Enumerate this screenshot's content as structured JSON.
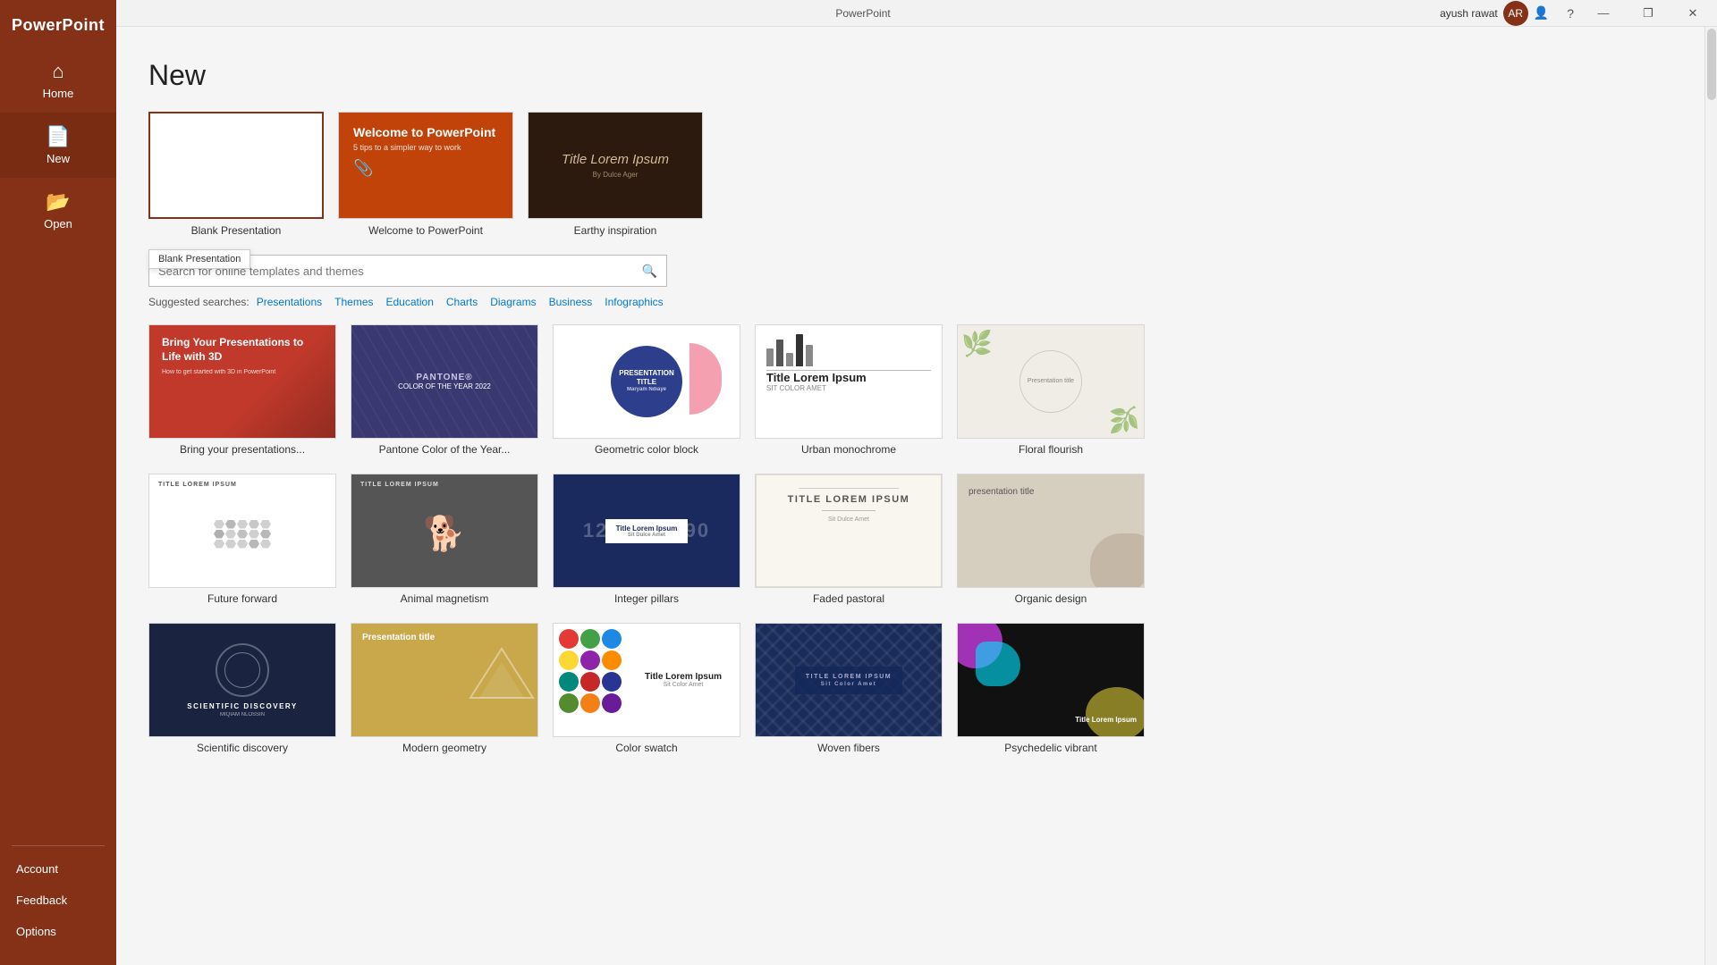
{
  "app": {
    "name": "PowerPoint",
    "title": "PowerPoint",
    "user": "ayush rawat",
    "user_initials": "AR"
  },
  "titlebar": {
    "minimize": "—",
    "restore": "❐",
    "close": "✕",
    "help": "?"
  },
  "sidebar": {
    "brand": "PowerPoint",
    "home_label": "Home",
    "new_label": "New",
    "open_label": "Open",
    "account_label": "Account",
    "feedback_label": "Feedback",
    "options_label": "Options"
  },
  "page": {
    "title": "New"
  },
  "featured": [
    {
      "label": "Blank Presentation",
      "tooltip": "Blank Presentation",
      "type": "blank",
      "selected": true
    },
    {
      "label": "Welcome to PowerPoint",
      "type": "welcome"
    },
    {
      "label": "Earthy inspiration",
      "type": "earthy"
    }
  ],
  "search": {
    "placeholder": "Search for online templates and themes",
    "value": ""
  },
  "suggested": {
    "label": "Suggested searches:",
    "items": [
      "Presentations",
      "Themes",
      "Education",
      "Charts",
      "Diagrams",
      "Business",
      "Infographics"
    ]
  },
  "templates": [
    {
      "id": "bring",
      "label": "Bring your presentations...",
      "type": "bring"
    },
    {
      "id": "pantone",
      "label": "Pantone Color of the Year...",
      "type": "pantone"
    },
    {
      "id": "geometric",
      "label": "Geometric color block",
      "type": "geometric"
    },
    {
      "id": "urban",
      "label": "Urban monochrome",
      "type": "urban"
    },
    {
      "id": "floral",
      "label": "Floral flourish",
      "type": "floral"
    },
    {
      "id": "future",
      "label": "Future forward",
      "type": "future"
    },
    {
      "id": "animal",
      "label": "Animal magnetism",
      "type": "animal"
    },
    {
      "id": "integer",
      "label": "Integer pillars",
      "type": "integer"
    },
    {
      "id": "faded",
      "label": "Faded pastoral",
      "type": "faded"
    },
    {
      "id": "organic",
      "label": "Organic design",
      "type": "organic"
    },
    {
      "id": "scientific",
      "label": "Scientific discovery",
      "type": "scientific"
    },
    {
      "id": "modern",
      "label": "Modern geometry",
      "type": "modern"
    },
    {
      "id": "color-swatch",
      "label": "Color swatch",
      "type": "color-swatch"
    },
    {
      "id": "woven",
      "label": "Woven fibers",
      "type": "woven"
    },
    {
      "id": "psychedelic",
      "label": "Psychedelic vibrant",
      "type": "psychedelic"
    }
  ],
  "welcome_thumb": {
    "title": "Welcome to PowerPoint",
    "sub": "5 tips to a simpler way to work"
  },
  "earthy_thumb": {
    "title": "Title Lorem Ipsum",
    "sub": "By Dulce Ager"
  },
  "bring_thumb": {
    "title": "Bring Your Presentations to Life with 3D",
    "sub": "How to get started with 3D in PowerPoint"
  },
  "pantone_thumb": {
    "text": "PANTONE®",
    "year": "COLOR OF THE YEAR 2022"
  },
  "geometric_thumb": {
    "title": "PRESENTATION TITLE",
    "sub": "Maryam Ndiaye"
  },
  "urban_thumb": {
    "title": "Title Lorem Ipsum",
    "sub": "SIT COLOR AMET"
  },
  "floral_thumb": {
    "label": "Presentation title"
  },
  "future_thumb": {
    "label": "TITLE LOREM IPSUM"
  },
  "animal_thumb": {
    "label": "TITLE LOREM IPSUM"
  },
  "integer_thumb": {
    "title": "Title Lorem Ipsum",
    "sub": "Sit Dulce Amet"
  },
  "faded_thumb": {
    "title": "TITLE LOREM IPSUM",
    "sub": "Sit Dulce Amet"
  },
  "organic_thumb": {
    "title": "presentation title"
  },
  "scientific_thumb": {
    "title": "SCIENTIFIC DISCOVERY",
    "sub": "MIQIAM NLOSSIN"
  },
  "modern_thumb": {
    "title": "Presentation title",
    "sub": ""
  },
  "color_swatch_thumb": {
    "title": "Title Lorem Ipsum",
    "sub": "Sit Color Amet"
  },
  "woven_thumb": {
    "title": "TITLE LOREM IPSUM",
    "sub": "Sit Color Amet"
  },
  "psychedelic_thumb": {
    "title": "Title Lorem Ipsum"
  }
}
